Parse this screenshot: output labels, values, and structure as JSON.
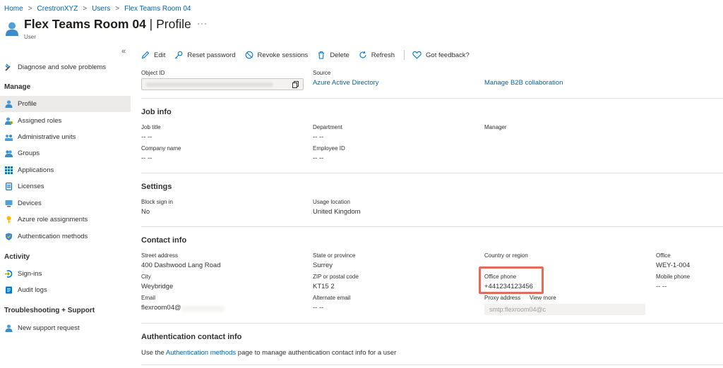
{
  "breadcrumb": [
    "Home",
    "CrestronXYZ",
    "Users",
    "Flex Teams Room 04"
  ],
  "header": {
    "title": "Flex Teams Room 04",
    "pipe": "|",
    "section": "Profile",
    "subtitle": "User",
    "more": "···"
  },
  "sidebar": {
    "collapse": "«",
    "top_item": "Diagnose and solve problems",
    "sections": {
      "manage": "Manage",
      "activity": "Activity",
      "troubleshooting": "Troubleshooting + Support"
    },
    "manage_items": [
      "Profile",
      "Assigned roles",
      "Administrative units",
      "Groups",
      "Applications",
      "Licenses",
      "Devices",
      "Azure role assignments",
      "Authentication methods"
    ],
    "activity_items": [
      "Sign-ins",
      "Audit logs"
    ],
    "support_items": [
      "New support request"
    ]
  },
  "toolbar": {
    "edit": "Edit",
    "reset_password": "Reset password",
    "revoke_sessions": "Revoke sessions",
    "delete": "Delete",
    "refresh": "Refresh",
    "feedback": "Got feedback?"
  },
  "identity": {
    "object_id_label": "Object ID",
    "source_label": "Source",
    "source_value": "Azure Active Directory",
    "manage_b2b": "Manage B2B collaboration"
  },
  "job_info": {
    "title": "Job info",
    "job_title_label": "Job title",
    "job_title_value": "-- --",
    "department_label": "Department",
    "department_value": "-- --",
    "manager_label": "Manager",
    "company_label": "Company name",
    "company_value": "-- --",
    "employee_id_label": "Employee ID",
    "employee_id_value": "-- --"
  },
  "settings": {
    "title": "Settings",
    "block_label": "Block sign in",
    "block_value": "No",
    "usage_label": "Usage location",
    "usage_value": "United Kingdom"
  },
  "contact": {
    "title": "Contact info",
    "street_label": "Street address",
    "street_value": "400 Dashwood Lang Road",
    "state_label": "State or province",
    "state_value": "Surrey",
    "country_label": "Country or region",
    "office_label": "Office",
    "office_value": "WEY-1-004",
    "city_label": "City",
    "city_value": "Weybridge",
    "zip_label": "ZIP or postal code",
    "zip_value": "KT15 2",
    "office_phone_label": "Office phone",
    "office_phone_value": "+441234123456",
    "mobile_label": "Mobile phone",
    "mobile_value": "-- --",
    "email_label": "Email",
    "email_value": "flexroom04@",
    "alt_email_label": "Alternate email",
    "alt_email_value": "-- --",
    "proxy_label": "Proxy address",
    "view_more": "View more",
    "proxy_value": "smtp:flexroom04@c"
  },
  "auth_contact": {
    "title": "Authentication contact info",
    "text_before": "Use the ",
    "link": "Authentication methods",
    "text_after": " page to manage authentication contact info for a user"
  },
  "colors": {
    "accent": "#0063b1",
    "highlight": "#e06c5a",
    "active_nav": "#edebe9"
  }
}
